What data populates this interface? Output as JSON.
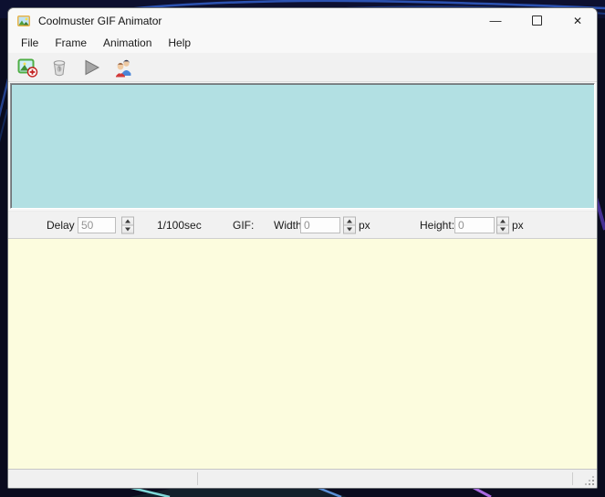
{
  "window": {
    "title": "Coolmuster GIF Animator",
    "controls": {
      "minimize_glyph": "—",
      "close_glyph": "✕"
    }
  },
  "menu": {
    "items": [
      {
        "label": "File"
      },
      {
        "label": "Frame"
      },
      {
        "label": "Animation"
      },
      {
        "label": "Help"
      }
    ]
  },
  "toolbar": {
    "buttons": [
      {
        "icon": "add-frame-icon"
      },
      {
        "icon": "delete-frame-icon"
      },
      {
        "icon": "play-icon"
      },
      {
        "icon": "users-icon"
      }
    ]
  },
  "controls": {
    "delay_label": "Delay :",
    "delay_value": "50",
    "delay_unit": "1/100sec",
    "gif_label": "GIF:",
    "width_label": "Width:",
    "width_value": "0",
    "width_unit": "px",
    "height_label": "Height:",
    "height_value": "0",
    "height_unit": "px"
  },
  "colors": {
    "frames_panel_bg": "#b2e0e3",
    "preview_bg": "#fcfcde",
    "chrome_bg": "#f1f1f1",
    "titlebar_bg": "#f8f8f8",
    "desktop_bg": "#0a0b1e",
    "desktop_swoosh_blue": "#2e56b8",
    "desktop_line_cyan": "#7fd8d8",
    "desktop_line_purple": "#a86ae0"
  }
}
